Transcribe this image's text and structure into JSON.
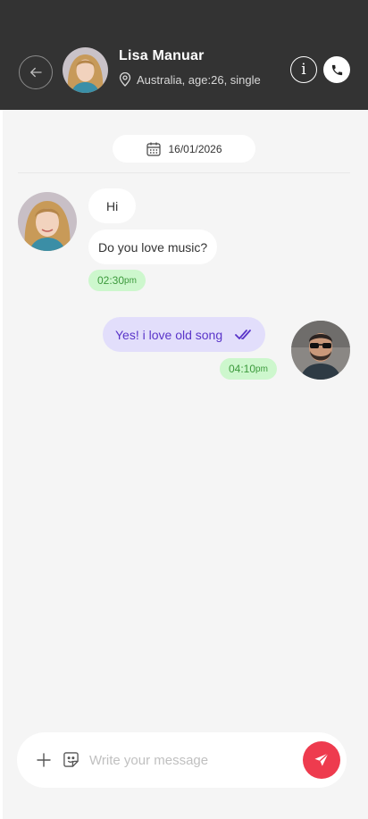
{
  "header": {
    "name": "Lisa Manuar",
    "subtitle": "Australia, age:26, single",
    "info_glyph": "i"
  },
  "date_divider": {
    "date": "16/01/2026"
  },
  "messages": [
    {
      "side": "left",
      "text": "Hi"
    },
    {
      "side": "left",
      "text": "Do you love music?",
      "time": "02:30",
      "time_suffix": "pm"
    },
    {
      "side": "right",
      "text": "Yes! i love old song",
      "time": "04:10",
      "time_suffix": "pm",
      "status": "double-check-read"
    }
  ],
  "composer": {
    "placeholder": "Write your message"
  },
  "colors": {
    "header_bg": "#333333",
    "chat_bg": "#f5f5f5",
    "sent_bubble": "#e2defb",
    "sent_text": "#5a35c9",
    "time_badge": "#cdf7cd",
    "time_text": "#3c9a3c",
    "send_button": "#ee3b4e"
  },
  "icons": [
    "arrow-left-icon",
    "location-pin-icon",
    "info-icon",
    "phone-icon",
    "calendar-icon",
    "double-check-icon",
    "plus-icon",
    "sticker-icon",
    "send-icon"
  ]
}
